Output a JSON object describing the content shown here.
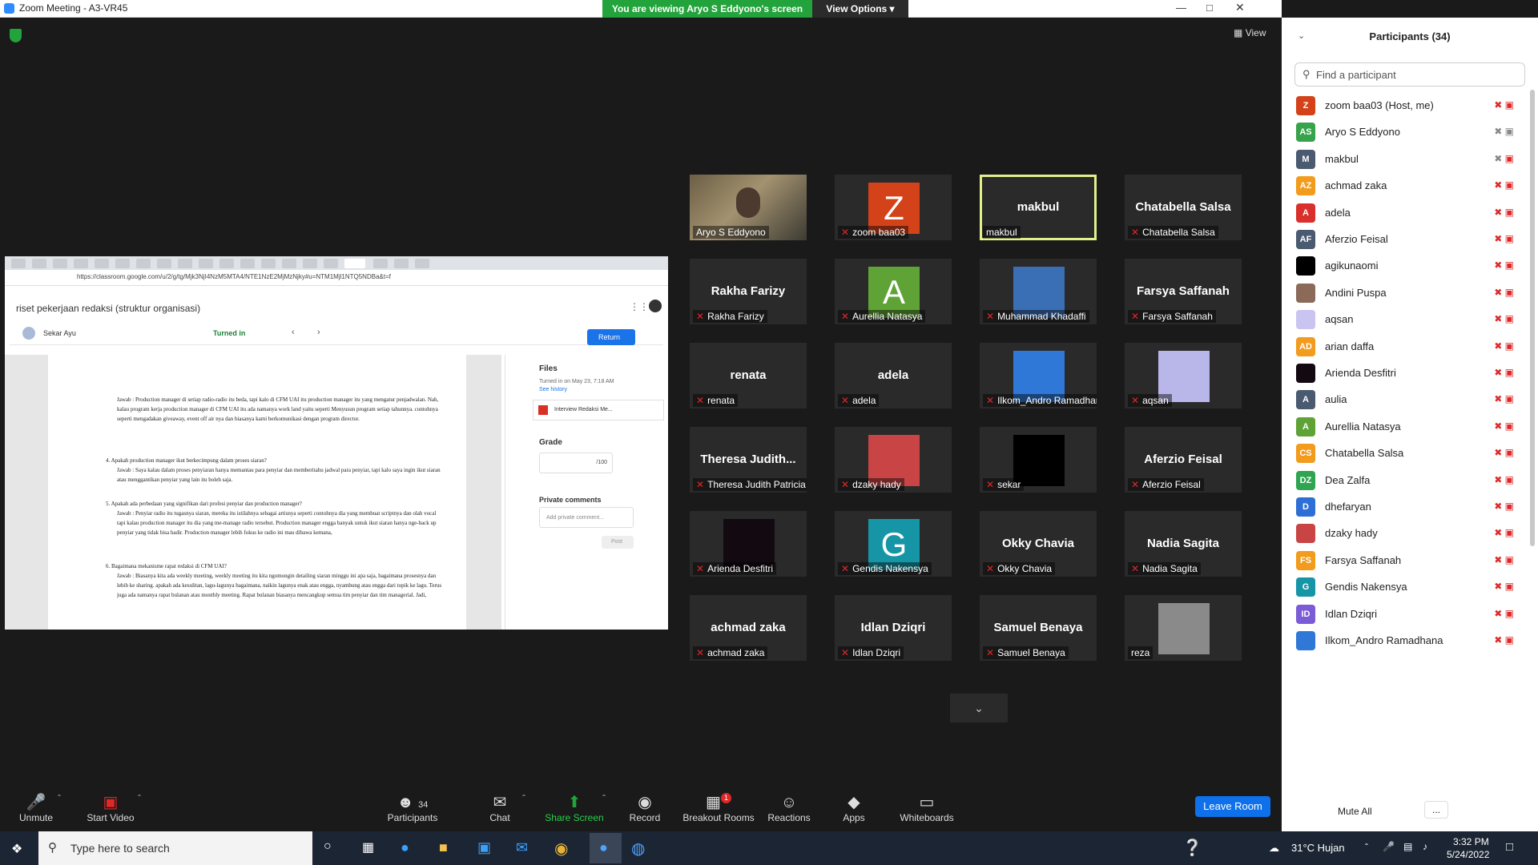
{
  "window": {
    "title": "Zoom Meeting - A3-VR45"
  },
  "share_bar": {
    "viewing": "You are viewing Aryo S Eddyono's screen",
    "view_options": "View Options"
  },
  "view_button": "View",
  "shared_screen": {
    "url": "https://classroom.google.com/u/2/g/tg/Mjk3NjI4NzM5MTA4/NTE1NzE2MjMzNjky#u=NTM1Mjl1NTQ5NDBa&t=f",
    "assignment_title": "riset pekerjaan redaksi (struktur organisasi)",
    "student_name": "Sekar Ayu",
    "status": "Turned in",
    "return_label": "Return",
    "files_heading": "Files",
    "turned_in_on": "Turned in on May 23, 7:18 AM",
    "see_history": "See history",
    "file_name": "Interview Redaksi Me...",
    "grade_heading": "Grade",
    "grade_max": "/100",
    "private_comments_heading": "Private comments",
    "comment_placeholder": "Add private comment...",
    "post_label": "Post",
    "doc_paragraphs": [
      "Jawab : Production manager di setiap radio-radio itu beda, tapi kalo di CFM UAI itu production manager itu yang mengatur penjadwalan. Nah, kalau program kerja production manager di CFM UAI itu ada namanya work land yaitu seperti Menyusun program setiap tahunnya. contohnya seperti mengadakan giveaway, event off air nya dan biasanya kami berkomunikasi dengan program director.",
      "4.   Apakah production manager ikut berkecimpung dalam proses siaran?",
      "Jawab : Saya kalau dalam proses penyiaran hanya memantau para penyiar dan memberitahu jadwal para penyiar, tapi kalo saya ingin ikut siaran atau menggantikan penyiar yang lain itu boleh saja.",
      "5.   Apakah ada perbedaan yang signifikan dari profesi penyiar dan production manager?",
      "Jawab : Penyiar radio itu tugasnya siaran, mereka itu istilahnya sebagai artisnya seperti contohnya dia yang membuat scriptnya dan olah vocal tapi kalau production manager itu dia yang me-manage radio tersebut. Production manager engga banyak untuk ikut siaran hanya nge-back up penyiar yang tidak bisa hadir. Production manager lebih fokus ke radio ini mau dibawa kemana,",
      "6.   Bagaimana mekanisme rapat redaksi di CFM UAI?",
      "Jawab : Biasanya kita ada weekly meeting, weekly meeting itu kita ngomongin detailing siaran minggu ini apa saja, bagaimana prosesnya dan lebih ke sharing. apakah ada kesulitan, lagu-lagunya bagaimana, naikin lagunya enak atau engga, nyambung atau engga dari topik ke lagu. Terus juga ada namanya rapat bulanan atau monthly meeting. Rapat bulanan biasanya mencangkup semua tim penyiar dan tim managerial. Jadi,"
    ]
  },
  "video_tiles": [
    {
      "label": "Aryo S Eddyono",
      "big": "",
      "avatar": "video",
      "muted": false
    },
    {
      "label": "zoom baa03",
      "big": "",
      "avatar": "Z",
      "color": "#d4421a",
      "muted": true
    },
    {
      "label": "makbul",
      "big": "makbul",
      "avatar": "",
      "muted": false,
      "active": true
    },
    {
      "label": "Chatabella Salsa",
      "big": "Chatabella Salsa",
      "avatar": "",
      "muted": true
    },
    {
      "label": "Rakha Farizy",
      "big": "Rakha Farizy",
      "avatar": "",
      "muted": true
    },
    {
      "label": "Aurellia Natasya",
      "big": "",
      "avatar": "A",
      "color": "#5fa336",
      "muted": true
    },
    {
      "label": "Muhammad Khadaffi",
      "big": "",
      "avatar": "photo",
      "color": "#3b6fb5",
      "muted": true
    },
    {
      "label": "Farsya Saffanah",
      "big": "Farsya Saffanah",
      "avatar": "",
      "muted": true
    },
    {
      "label": "renata",
      "big": "renata",
      "avatar": "",
      "muted": true
    },
    {
      "label": "adela",
      "big": "adela",
      "avatar": "",
      "muted": true
    },
    {
      "label": "Ilkom_Andro Ramadhana",
      "big": "",
      "avatar": "photo",
      "color": "#2f78d8",
      "muted": true
    },
    {
      "label": "aqsan",
      "big": "",
      "avatar": "photo",
      "color": "#b9b6ea",
      "muted": true
    },
    {
      "label": "Theresa Judith Patricia",
      "big": "Theresa Judith...",
      "avatar": "",
      "muted": true
    },
    {
      "label": "dzaky hady",
      "big": "",
      "avatar": "photo",
      "color": "#c94545",
      "muted": true
    },
    {
      "label": "sekar",
      "big": "",
      "avatar": "photo",
      "color": "#000000",
      "muted": true
    },
    {
      "label": "Aferzio Feisal",
      "big": "Aferzio Feisal",
      "avatar": "",
      "muted": true
    },
    {
      "label": "Arienda Desfitri",
      "big": "",
      "avatar": "photo",
      "color": "#120a10",
      "muted": true
    },
    {
      "label": "Gendis Nakensya",
      "big": "",
      "avatar": "G",
      "color": "#1695a7",
      "muted": true
    },
    {
      "label": "Okky Chavia",
      "big": "Okky Chavia",
      "avatar": "",
      "muted": true
    },
    {
      "label": "Nadia Sagita",
      "big": "Nadia Sagita",
      "avatar": "",
      "muted": true
    },
    {
      "label": "achmad zaka",
      "big": "achmad zaka",
      "avatar": "",
      "muted": true
    },
    {
      "label": "Idlan Dziqri",
      "big": "Idlan Dziqri",
      "avatar": "",
      "muted": true
    },
    {
      "label": "Samuel Benaya",
      "big": "Samuel Benaya",
      "avatar": "",
      "muted": true
    },
    {
      "label": "reza",
      "big": "",
      "avatar": "photo",
      "color": "#8a8a8a",
      "muted": false
    }
  ],
  "toolbar": {
    "unmute": "Unmute",
    "start_video": "Start Video",
    "participants": "Participants",
    "participants_count": "34",
    "chat": "Chat",
    "share_screen": "Share Screen",
    "record": "Record",
    "breakout_rooms": "Breakout Rooms",
    "breakout_badge": "1",
    "reactions": "Reactions",
    "apps": "Apps",
    "whiteboards": "Whiteboards",
    "leave": "Leave Room"
  },
  "panel": {
    "title": "Participants (34)",
    "search_placeholder": "Find a participant",
    "mute_all": "Mute All",
    "more": "...",
    "participants": [
      {
        "initials": "Z",
        "name": "zoom baa03 (Host, me)",
        "color": "#d4421a"
      },
      {
        "initials": "AS",
        "name": "Aryo S Eddyono",
        "color": "#37a34a"
      },
      {
        "initials": "M",
        "name": "makbul",
        "color": "#4a5a70"
      },
      {
        "initials": "AZ",
        "name": "achmad zaka",
        "color": "#f29b1c"
      },
      {
        "initials": "A",
        "name": "adela",
        "color": "#d9302c"
      },
      {
        "initials": "AF",
        "name": "Aferzio Feisal",
        "color": "#4a5a70"
      },
      {
        "initials": "",
        "name": "agikunaomi",
        "color": "#000000"
      },
      {
        "initials": "",
        "name": "Andini Puspa",
        "color": "#8c6a5a"
      },
      {
        "initials": "",
        "name": "aqsan",
        "color": "#c9c5f0"
      },
      {
        "initials": "AD",
        "name": "arian daffa",
        "color": "#f29b1c"
      },
      {
        "initials": "",
        "name": "Arienda Desfitri",
        "color": "#120a10"
      },
      {
        "initials": "A",
        "name": "aulia",
        "color": "#4a5a70"
      },
      {
        "initials": "A",
        "name": "Aurellia Natasya",
        "color": "#5fa336"
      },
      {
        "initials": "CS",
        "name": "Chatabella Salsa",
        "color": "#f29b1c"
      },
      {
        "initials": "DZ",
        "name": "Dea Zalfa",
        "color": "#2fa552"
      },
      {
        "initials": "D",
        "name": "dhefaryan",
        "color": "#2d6fd6"
      },
      {
        "initials": "",
        "name": "dzaky hady",
        "color": "#c94545"
      },
      {
        "initials": "FS",
        "name": "Farsya Saffanah",
        "color": "#f29b1c"
      },
      {
        "initials": "G",
        "name": "Gendis Nakensya",
        "color": "#1695a7"
      },
      {
        "initials": "ID",
        "name": "Idlan Dziqri",
        "color": "#7b5bd6"
      },
      {
        "initials": "",
        "name": "Ilkom_Andro Ramadhana",
        "color": "#2f78d8"
      }
    ]
  },
  "taskbar": {
    "search_placeholder": "Type here to search",
    "weather": "31°C  Hujan",
    "time": "3:32 PM",
    "date": "5/24/2022"
  }
}
